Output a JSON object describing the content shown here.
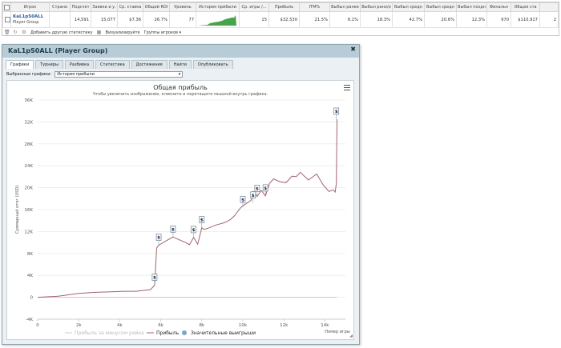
{
  "stats_table": {
    "headers": [
      "Игрок",
      "Страна",
      "Подсчет",
      "Заявки и у.",
      "Ср. ставка",
      "Общий ROI",
      "Уровень",
      "История прибыли",
      "Ср. игры /...",
      "Прибыль",
      "ITM%",
      "Выбыл ранее",
      "Выбыл рано/о",
      "Выбыл средн",
      "Выбыл средн",
      "Выбыл поздн",
      "Финальн",
      "Общая ста"
    ],
    "row": {
      "player_name": "KaL1pS0ALL",
      "player_group": "Player Group",
      "country": "",
      "count": "14,591",
      "entries": "15,077",
      "avg_stake": "$7.36",
      "roi": "26.7%",
      "level": "77",
      "avg_games": "15",
      "profit": "$32,530",
      "itm": "21.5%",
      "early": "6.1%",
      "early_mid": "18.3%",
      "mid1": "42.7%",
      "mid2": "20.6%",
      "late": "12.3%",
      "final": "970",
      "total": "$110,917",
      "extra": "2"
    }
  },
  "toolbar": {
    "add_stats": "Добавить другую статистику",
    "visualize": "Визуализируйте",
    "player_groups": "Группы игроков"
  },
  "dialog": {
    "title": "KaL1pS0ALL (Player Group)",
    "tabs": [
      "Графики",
      "Турниры",
      "Разбивка",
      "Статистика",
      "Достижения",
      "Найти",
      "Опубликовать"
    ],
    "active_tab": 0,
    "selector_label": "Выбранные графики:",
    "selector_value": "История прибыли"
  },
  "chart_data": {
    "type": "line",
    "title": "Общая прибыль",
    "subtitle": "Чтобы увеличить изображение, кликните и перетащите мышкой внутрь графика.",
    "xlabel": "Номер игры",
    "ylabel": "Суммарный итог (USD)",
    "xlim": [
      0,
      15000
    ],
    "ylim": [
      -4000,
      36000
    ],
    "x_ticks": [
      "0",
      "2k",
      "4k",
      "6k",
      "8k",
      "10k",
      "12k",
      "14k"
    ],
    "y_ticks": [
      "-4K",
      "0",
      "4K",
      "8K",
      "12K",
      "16K",
      "20K",
      "24K",
      "28K",
      "32K",
      "36K"
    ],
    "legend_position": "bottom",
    "series": [
      {
        "name": "Прибыль",
        "color": "#a0636e",
        "x": [
          0,
          1000,
          2000,
          2800,
          3600,
          4200,
          4800,
          5500,
          5700,
          5800,
          5900,
          6300,
          6600,
          6900,
          7200,
          7400,
          7600,
          7800,
          8000,
          8100,
          8300,
          8700,
          9100,
          9400,
          9600,
          9900,
          10200,
          10400,
          10500,
          10700,
          10900,
          11100,
          11300,
          11500,
          11800,
          12100,
          12400,
          12600,
          12800,
          13200,
          13600,
          13900,
          14200,
          14400,
          14500,
          14560,
          14591
        ],
        "y": [
          0,
          200,
          700,
          900,
          1000,
          1100,
          1100,
          1400,
          2200,
          9000,
          9500,
          10400,
          11000,
          10500,
          10000,
          9600,
          10900,
          9700,
          12700,
          12400,
          12600,
          13200,
          13600,
          14200,
          14900,
          16400,
          17200,
          17700,
          19300,
          18400,
          19500,
          18500,
          20800,
          21600,
          21100,
          20900,
          22100,
          22000,
          22800,
          21400,
          22500,
          20600,
          19300,
          19600,
          19200,
          20800,
          32500
        ]
      },
      {
        "name": "Прибыль за минусом рейка",
        "color": "#dfc0c5",
        "x": [
          0,
          14591
        ],
        "y": [
          0,
          0
        ]
      }
    ],
    "markers": {
      "name": "Значительные выигрыши",
      "color": "#7aa6c6",
      "label": "$",
      "points": [
        {
          "x": 5700,
          "y": 2200
        },
        {
          "x": 5900,
          "y": 9500
        },
        {
          "x": 6600,
          "y": 11000
        },
        {
          "x": 7600,
          "y": 10900
        },
        {
          "x": 8000,
          "y": 12700
        },
        {
          "x": 10000,
          "y": 16400
        },
        {
          "x": 10500,
          "y": 17200
        },
        {
          "x": 10700,
          "y": 18400
        },
        {
          "x": 11100,
          "y": 18500
        },
        {
          "x": 14560,
          "y": 32500
        }
      ]
    }
  }
}
